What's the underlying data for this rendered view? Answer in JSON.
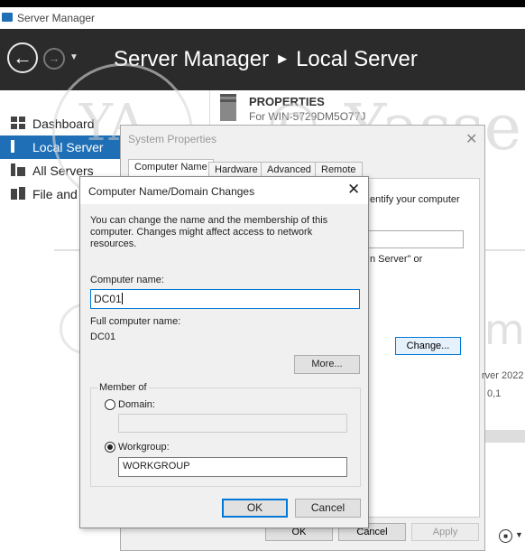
{
  "window": {
    "title": "Server Manager"
  },
  "header": {
    "crumb_app": "Server Manager",
    "crumb_page": "Local Server"
  },
  "sidebar": {
    "items": [
      {
        "label": "Dashboard"
      },
      {
        "label": "Local Server",
        "active": true
      },
      {
        "label": "All Servers"
      },
      {
        "label": "File and"
      }
    ]
  },
  "properties": {
    "title": "PROPERTIES",
    "subtitle": "For WIN-5729DM5O77J"
  },
  "watermark": {
    "main": "© Yasse",
    "url": "yasseralrajeh.com",
    "logo": "YA"
  },
  "system_properties": {
    "title": "System Properties",
    "tabs": [
      "Computer Name",
      "Hardware",
      "Advanced",
      "Remote"
    ],
    "text_identify": "entify your computer",
    "text_server": "n Server\" or",
    "change_label": "Change...",
    "text_version": "rver 2022",
    "text_number": "0,1",
    "ok_label": "OK",
    "cancel_label": "Cancel",
    "apply_label": "Apply"
  },
  "computer_name_dialog": {
    "title": "Computer Name/Domain Changes",
    "description": "You can change the name and the membership of this computer. Changes might affect access to network resources.",
    "computer_name_label": "Computer name:",
    "computer_name_value": "DC01",
    "full_name_label": "Full computer name:",
    "full_name_value": "DC01",
    "more_label": "More...",
    "member_of_label": "Member of",
    "domain_label": "Domain:",
    "domain_value": "",
    "workgroup_label": "Workgroup:",
    "workgroup_value": "WORKGROUP",
    "selected_membership": "workgroup",
    "ok_label": "OK",
    "cancel_label": "Cancel"
  },
  "colors": {
    "accent": "#1e6fb5",
    "header_bg": "#2b2b2b",
    "focus": "#0078d7"
  }
}
